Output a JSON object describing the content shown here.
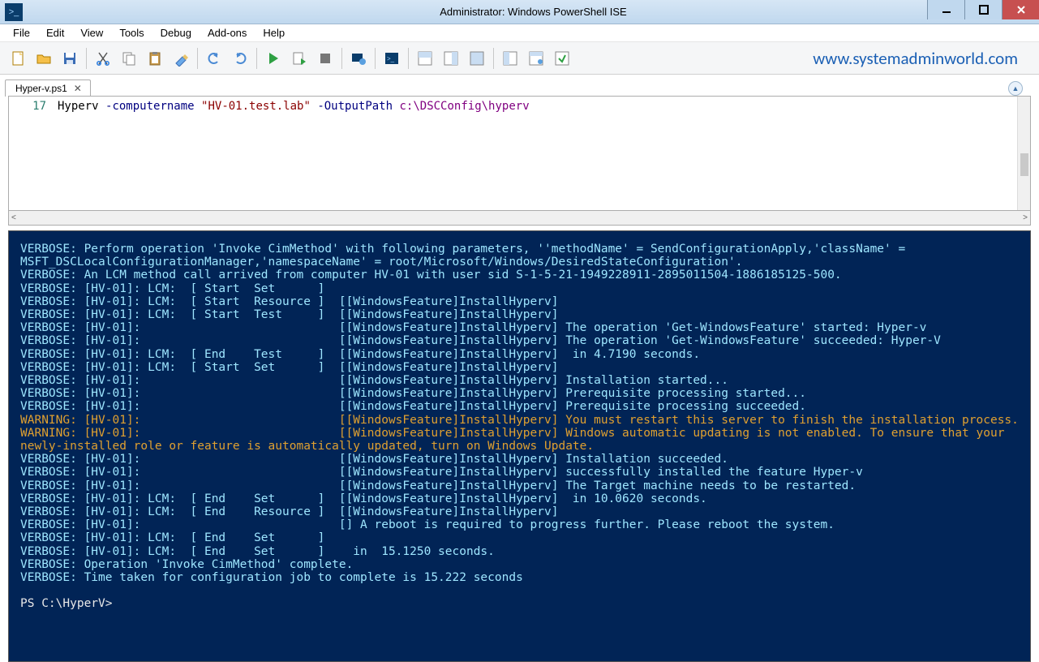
{
  "window": {
    "title": "Administrator: Windows PowerShell ISE"
  },
  "menu": {
    "items": [
      "File",
      "Edit",
      "View",
      "Tools",
      "Debug",
      "Add-ons",
      "Help"
    ]
  },
  "toolbar": {
    "brand": "www.systemadminworld.com"
  },
  "tab": {
    "name": "Hyper-v.ps1"
  },
  "editor": {
    "line_number": "17",
    "cmd": "Hyperv",
    "param1": "-computername",
    "str": "\"HV-01.test.lab\"",
    "param2": "-OutputPath",
    "path": "c:\\DSCConfig\\hyperv"
  },
  "console": {
    "lines": [
      {
        "cls": "verbose",
        "text": "VERBOSE: Perform operation 'Invoke CimMethod' with following parameters, ''methodName' = SendConfigurationApply,'className' = MSFT_DSCLocalConfigurationManager,'namespaceName' = root/Microsoft/Windows/DesiredStateConfiguration'."
      },
      {
        "cls": "verbose",
        "text": "VERBOSE: An LCM method call arrived from computer HV-01 with user sid S-1-5-21-1949228911-2895011504-1886185125-500."
      },
      {
        "cls": "verbose",
        "text": "VERBOSE: [HV-01]: LCM:  [ Start  Set      ]"
      },
      {
        "cls": "verbose",
        "text": "VERBOSE: [HV-01]: LCM:  [ Start  Resource ]  [[WindowsFeature]InstallHyperv]"
      },
      {
        "cls": "verbose",
        "text": "VERBOSE: [HV-01]: LCM:  [ Start  Test     ]  [[WindowsFeature]InstallHyperv]"
      },
      {
        "cls": "verbose",
        "text": "VERBOSE: [HV-01]:                            [[WindowsFeature]InstallHyperv] The operation 'Get-WindowsFeature' started: Hyper-v"
      },
      {
        "cls": "verbose",
        "text": "VERBOSE: [HV-01]:                            [[WindowsFeature]InstallHyperv] The operation 'Get-WindowsFeature' succeeded: Hyper-V"
      },
      {
        "cls": "verbose",
        "text": "VERBOSE: [HV-01]: LCM:  [ End    Test     ]  [[WindowsFeature]InstallHyperv]  in 4.7190 seconds."
      },
      {
        "cls": "verbose",
        "text": "VERBOSE: [HV-01]: LCM:  [ Start  Set      ]  [[WindowsFeature]InstallHyperv]"
      },
      {
        "cls": "verbose",
        "text": "VERBOSE: [HV-01]:                            [[WindowsFeature]InstallHyperv] Installation started..."
      },
      {
        "cls": "verbose",
        "text": "VERBOSE: [HV-01]:                            [[WindowsFeature]InstallHyperv] Prerequisite processing started..."
      },
      {
        "cls": "verbose",
        "text": "VERBOSE: [HV-01]:                            [[WindowsFeature]InstallHyperv] Prerequisite processing succeeded."
      },
      {
        "cls": "warning",
        "text": "WARNING: [HV-01]:                            [[WindowsFeature]InstallHyperv] You must restart this server to finish the installation process."
      },
      {
        "cls": "warning",
        "text": "WARNING: [HV-01]:                            [[WindowsFeature]InstallHyperv] Windows automatic updating is not enabled. To ensure that your newly-installed role or feature is automatically updated, turn on Windows Update."
      },
      {
        "cls": "verbose",
        "text": "VERBOSE: [HV-01]:                            [[WindowsFeature]InstallHyperv] Installation succeeded."
      },
      {
        "cls": "verbose",
        "text": "VERBOSE: [HV-01]:                            [[WindowsFeature]InstallHyperv] successfully installed the feature Hyper-v"
      },
      {
        "cls": "verbose",
        "text": "VERBOSE: [HV-01]:                            [[WindowsFeature]InstallHyperv] The Target machine needs to be restarted."
      },
      {
        "cls": "verbose",
        "text": "VERBOSE: [HV-01]: LCM:  [ End    Set      ]  [[WindowsFeature]InstallHyperv]  in 10.0620 seconds."
      },
      {
        "cls": "verbose",
        "text": "VERBOSE: [HV-01]: LCM:  [ End    Resource ]  [[WindowsFeature]InstallHyperv]"
      },
      {
        "cls": "verbose",
        "text": "VERBOSE: [HV-01]:                            [] A reboot is required to progress further. Please reboot the system."
      },
      {
        "cls": "verbose",
        "text": "VERBOSE: [HV-01]: LCM:  [ End    Set      ]"
      },
      {
        "cls": "verbose",
        "text": "VERBOSE: [HV-01]: LCM:  [ End    Set      ]    in  15.1250 seconds."
      },
      {
        "cls": "verbose",
        "text": "VERBOSE: Operation 'Invoke CimMethod' complete."
      },
      {
        "cls": "verbose",
        "text": "VERBOSE: Time taken for configuration job to complete is 15.222 seconds"
      }
    ],
    "prompt": "PS C:\\HyperV>"
  }
}
